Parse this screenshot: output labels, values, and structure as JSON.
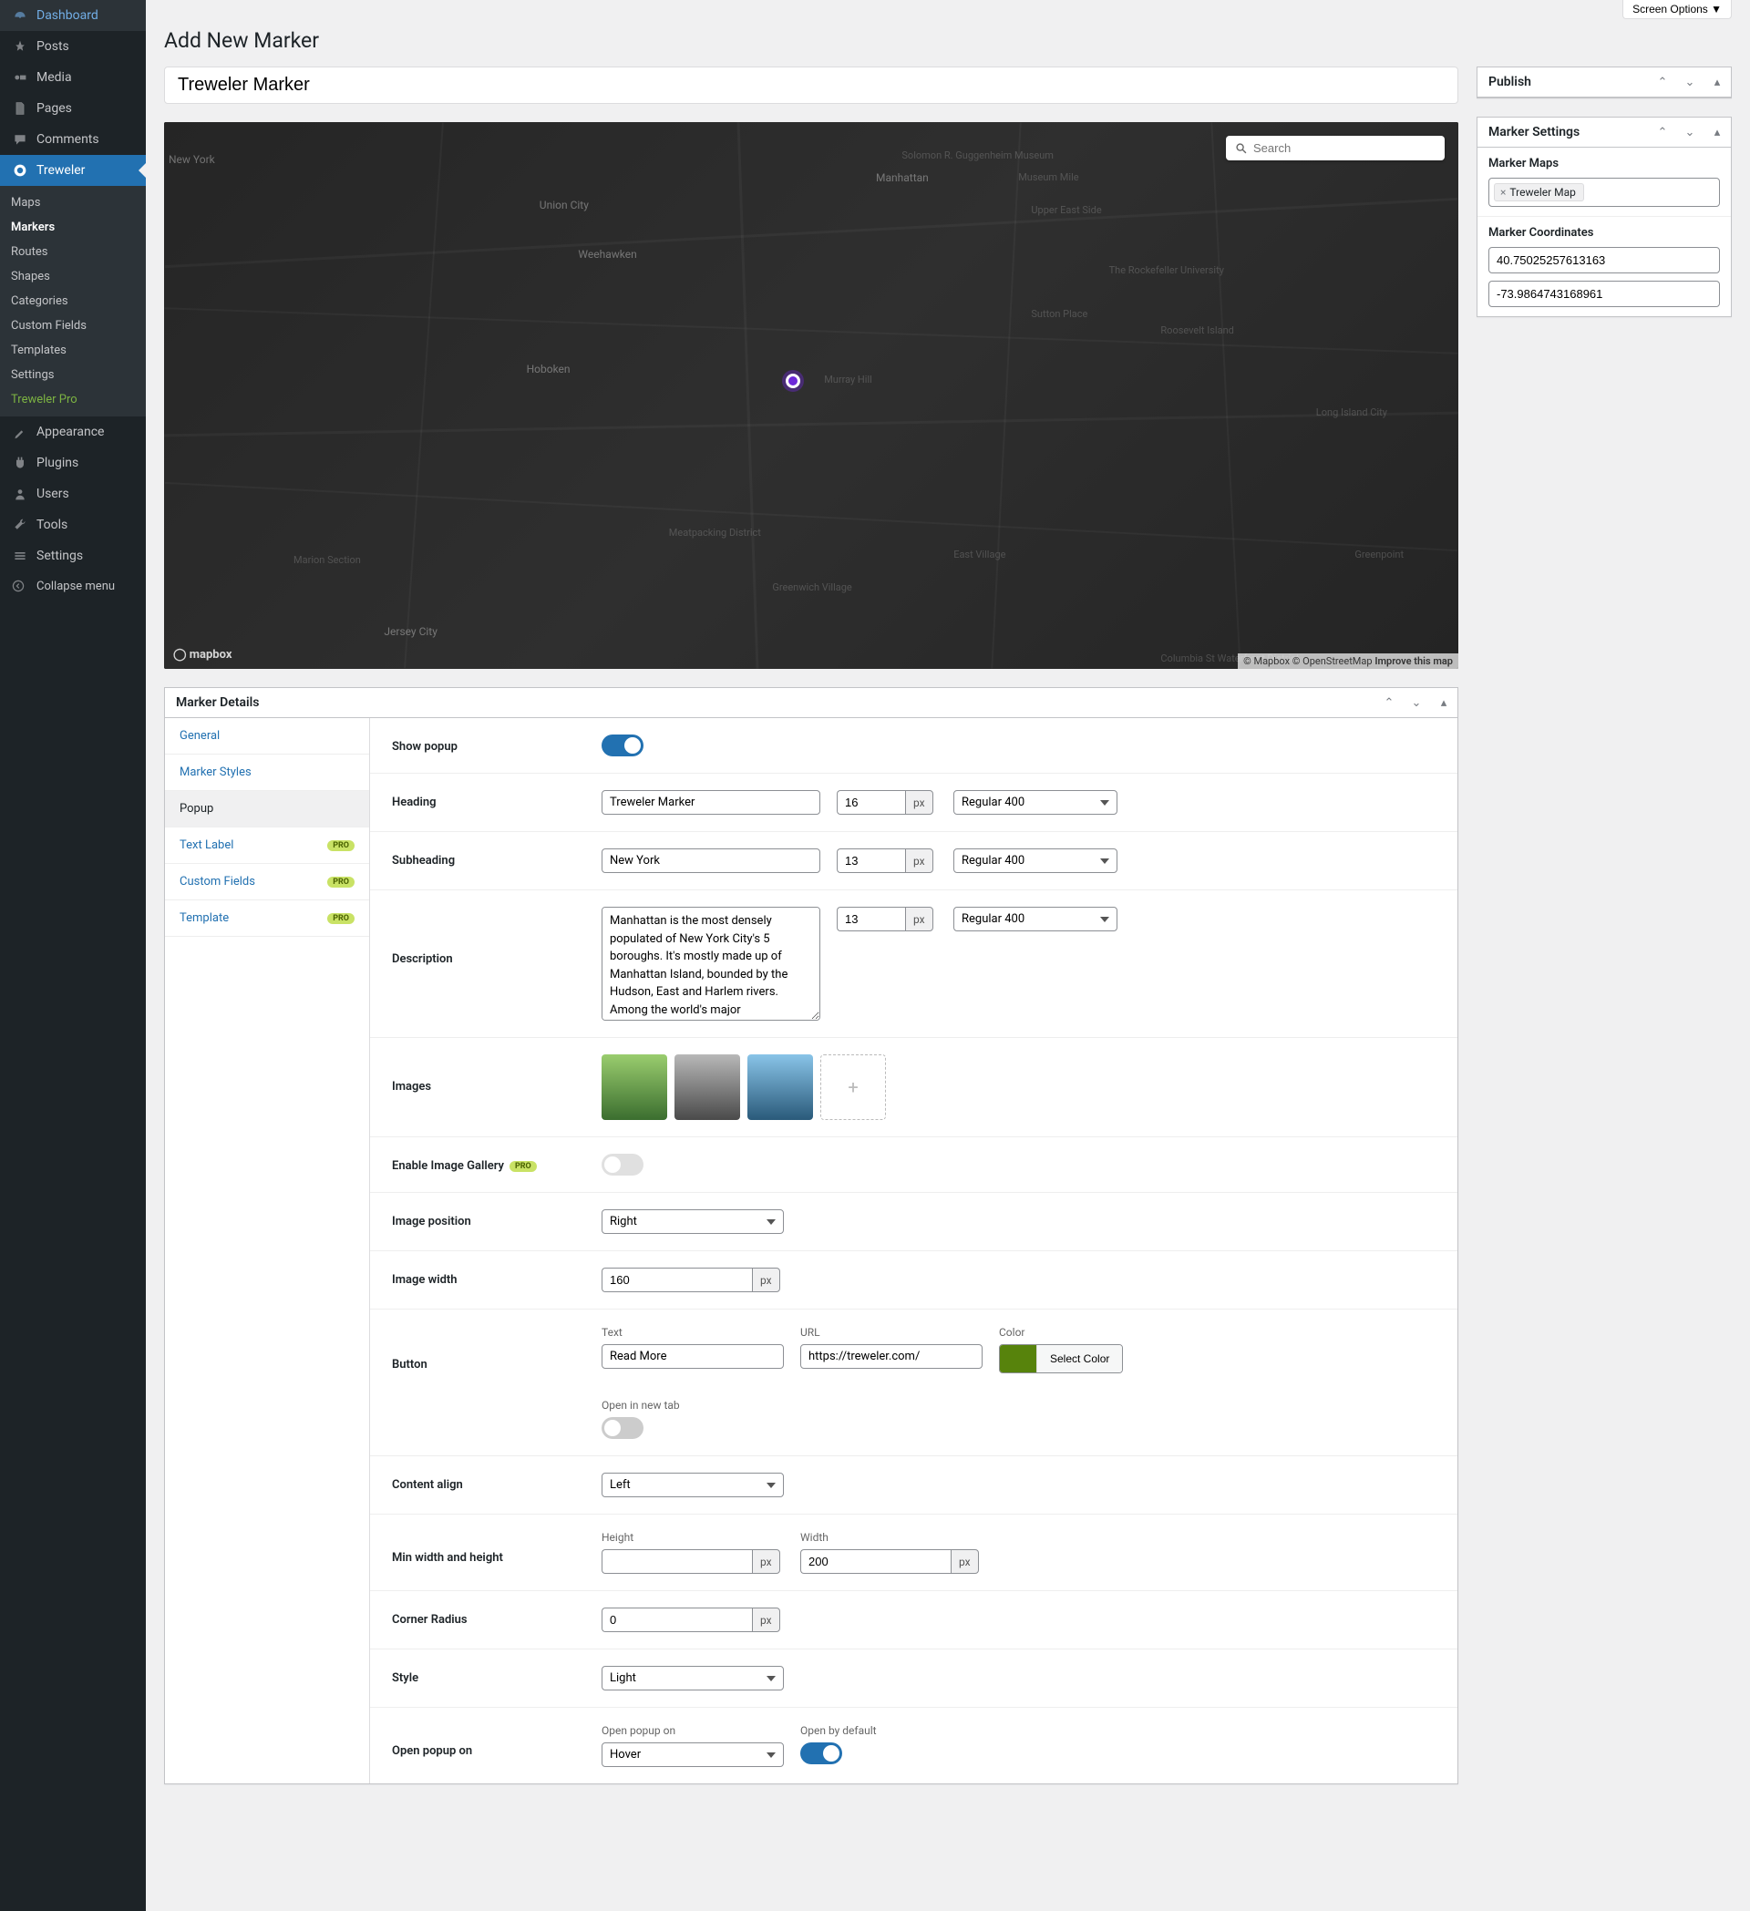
{
  "screenOptions": "Screen Options ▼",
  "pageTitle": "Add New Marker",
  "markerTitle": "Treweler Marker",
  "sidebar": {
    "items": [
      {
        "label": "Dashboard",
        "icon": "dashboard"
      },
      {
        "label": "Posts",
        "icon": "pushpin"
      },
      {
        "label": "Media",
        "icon": "media"
      },
      {
        "label": "Pages",
        "icon": "page"
      },
      {
        "label": "Comments",
        "icon": "comment"
      },
      {
        "label": "Treweler",
        "icon": "map-pin",
        "active": true
      },
      {
        "label": "Appearance",
        "icon": "brush"
      },
      {
        "label": "Plugins",
        "icon": "plug"
      },
      {
        "label": "Users",
        "icon": "user"
      },
      {
        "label": "Tools",
        "icon": "wrench"
      },
      {
        "label": "Settings",
        "icon": "gears"
      }
    ],
    "submenu": [
      {
        "label": "Maps"
      },
      {
        "label": "Markers",
        "current": true
      },
      {
        "label": "Routes"
      },
      {
        "label": "Shapes"
      },
      {
        "label": "Categories"
      },
      {
        "label": "Custom Fields"
      },
      {
        "label": "Templates"
      },
      {
        "label": "Settings"
      },
      {
        "label": "Treweler Pro",
        "pro": true
      }
    ],
    "collapse": "Collapse menu"
  },
  "map": {
    "searchPlaceholder": "Search",
    "logo": "mapbox",
    "attr1": "© Mapbox",
    "attr2": "© OpenStreetMap",
    "improve": "Improve this map",
    "labels": {
      "unionCity": "Union City",
      "manhattan": "Manhattan",
      "weehawken": "Weehawken",
      "hoboken": "Hoboken",
      "jerseyCity": "Jersey City",
      "murrayHill": "Murray Hill",
      "rockefeller": "The Rockefeller University",
      "roosevelt": "Roosevelt Island",
      "eastVillage": "East Village",
      "greenwich": "Greenwich Village",
      "longIsland": "Long Island City",
      "greenpoint": "Greenpoint",
      "meatpacking": "Meatpacking District",
      "columbia": "Columbia St Waterfront District",
      "marionSection": "Marion Section",
      "museumMile": "Museum Mile",
      "upperEast": "Upper East Side",
      "newYork": "New York",
      "solomonMuseum": "Solomon R. Guggenheim Museum",
      "sutton": "Sutton Place"
    }
  },
  "publish": {
    "title": "Publish"
  },
  "markerSettings": {
    "title": "Marker Settings",
    "mapsLabel": "Marker Maps",
    "mapTag": "Treweler Map",
    "coordsLabel": "Marker Coordinates",
    "lat": "40.75025257613163",
    "lng": "-73.9864743168961"
  },
  "details": {
    "title": "Marker Details",
    "tabs": [
      {
        "label": "General"
      },
      {
        "label": "Marker Styles"
      },
      {
        "label": "Popup",
        "active": true
      },
      {
        "label": "Text Label",
        "pro": true
      },
      {
        "label": "Custom Fields",
        "pro": true
      },
      {
        "label": "Template",
        "pro": true
      }
    ],
    "fields": {
      "showPopup": {
        "label": "Show popup",
        "value": true
      },
      "heading": {
        "label": "Heading",
        "value": "Treweler Marker",
        "fontSize": "16",
        "fontWeight": "Regular 400"
      },
      "subheading": {
        "label": "Subheading",
        "value": "New York",
        "fontSize": "13",
        "fontWeight": "Regular 400"
      },
      "description": {
        "label": "Description",
        "value": "Manhattan is the most densely populated of New York City's 5 boroughs. It's mostly made up of Manhattan Island, bounded by the Hudson, East and Harlem rivers. Among the world's major",
        "fontSize": "13",
        "fontWeight": "Regular 400"
      },
      "images": {
        "label": "Images"
      },
      "enableGallery": {
        "label": "Enable Image Gallery",
        "value": false,
        "pro": true
      },
      "imagePosition": {
        "label": "Image position",
        "value": "Right"
      },
      "imageWidth": {
        "label": "Image width",
        "value": "160"
      },
      "button": {
        "label": "Button",
        "textLabel": "Text",
        "text": "Read More",
        "urlLabel": "URL",
        "url": "https://treweler.com/",
        "colorLabel": "Color",
        "colorBtn": "Select Color",
        "color": "#57830c",
        "newTabLabel": "Open in new tab",
        "newTab": false
      },
      "contentAlign": {
        "label": "Content align",
        "value": "Left"
      },
      "minWH": {
        "label": "Min width and height",
        "heightLabel": "Height",
        "height": "",
        "widthLabel": "Width",
        "width": "200"
      },
      "cornerRadius": {
        "label": "Corner Radius",
        "value": "0"
      },
      "style": {
        "label": "Style",
        "value": "Light"
      },
      "openPopup": {
        "label": "Open popup on",
        "triggerLabel": "Open popup on",
        "trigger": "Hover",
        "defaultLabel": "Open by default",
        "default": true
      }
    }
  },
  "pxUnit": "px",
  "proBadge": "PRO"
}
